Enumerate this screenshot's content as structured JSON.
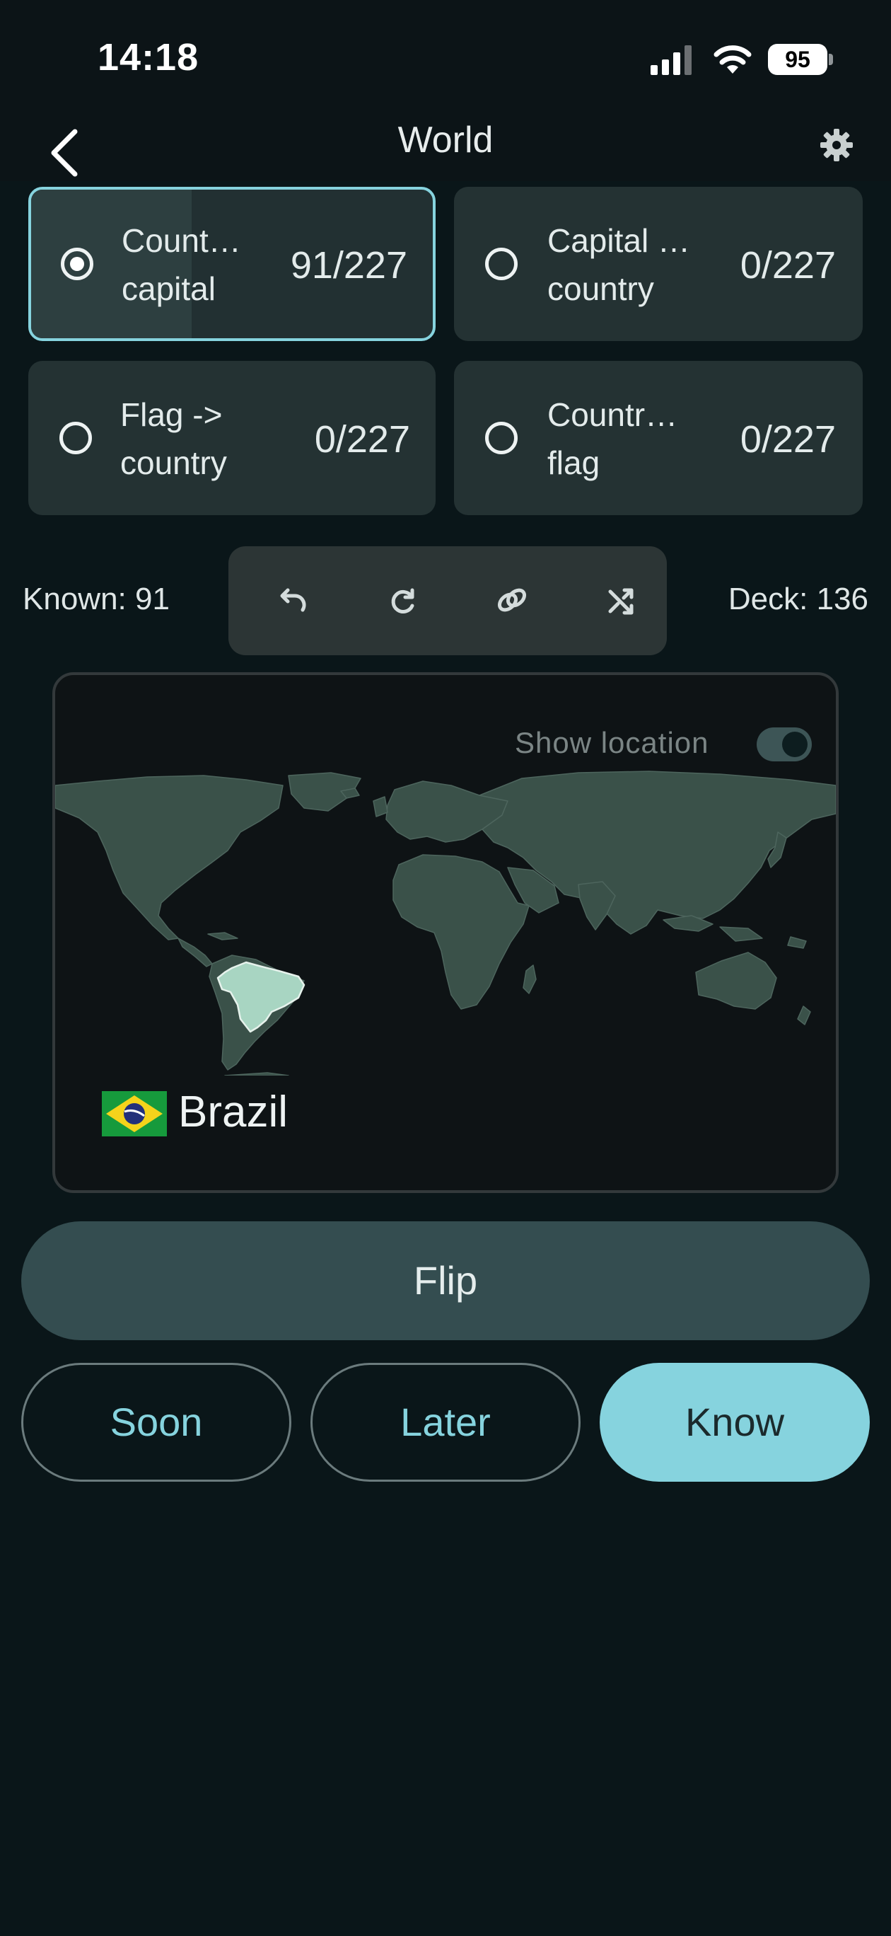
{
  "status_bar": {
    "time": "14:18",
    "battery": "95",
    "icons": [
      "signal-icon",
      "wifi-icon",
      "battery-icon"
    ]
  },
  "header": {
    "title": "World",
    "back_icon": "chevron-left-icon",
    "settings_icon": "gear-icon"
  },
  "modes": [
    {
      "label_line1": "Count…",
      "label_line2": "capital",
      "count": "91/227",
      "selected": true,
      "progress": 0.4
    },
    {
      "label_line1": "Capital …",
      "label_line2": "country",
      "count": "0/227",
      "selected": false,
      "progress": 0
    },
    {
      "label_line1": "Flag ->",
      "label_line2": "country",
      "count": "0/227",
      "selected": false,
      "progress": 0
    },
    {
      "label_line1": "Countr…",
      "label_line2": "flag",
      "count": "0/227",
      "selected": false,
      "progress": 0
    }
  ],
  "stats": {
    "known": "Known: 91",
    "deck": "Deck: 136"
  },
  "toolbar": {
    "icons": [
      "undo-icon",
      "redo-icon",
      "link-icon",
      "shuffle-icon"
    ]
  },
  "card": {
    "show_location_label": "Show location",
    "show_location_on": true,
    "country_name": "Brazil",
    "flag_icon": "brazil-flag-icon"
  },
  "actions": {
    "flip": "Flip",
    "soon": "Soon",
    "later": "Later",
    "know": "Know"
  },
  "colors": {
    "accent": "#86d3de",
    "background": "#0a1619",
    "card": "#243233",
    "land": "#3a5149",
    "highlight": "#a8d5c2"
  }
}
